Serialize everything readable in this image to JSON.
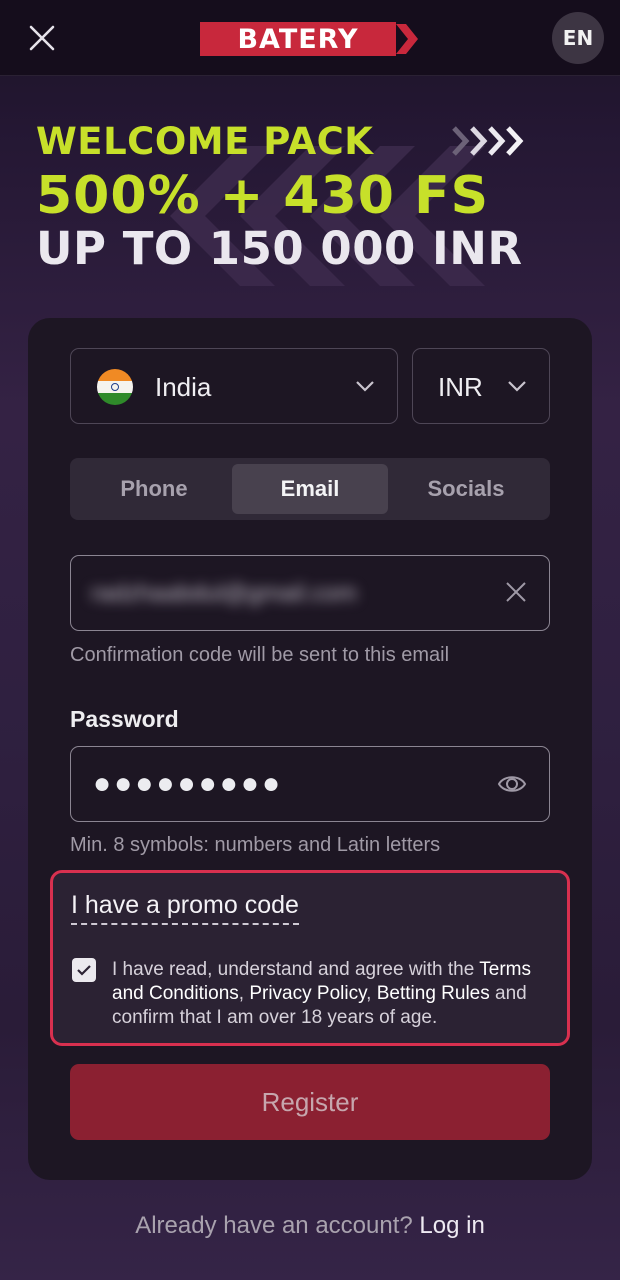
{
  "header": {
    "logo_text": "BATERY",
    "lang": "EN"
  },
  "banner": {
    "line1": "WELCOME PACK",
    "line2": "500% + 430 FS",
    "line3": "UP TO 150 000 INR"
  },
  "form": {
    "country": {
      "label": "India",
      "flag": "india-flag"
    },
    "currency": {
      "label": "INR"
    },
    "tabs": [
      {
        "label": "Phone",
        "active": false
      },
      {
        "label": "Email",
        "active": true
      },
      {
        "label": "Socials",
        "active": false
      }
    ],
    "email": {
      "value": "radzhaabdul@gmail.com",
      "hint": "Confirmation code will be sent to this email"
    },
    "password": {
      "label": "Password",
      "value": "●●●●●●●●●",
      "hint": "Min. 8 symbols: numbers and Latin letters"
    },
    "promo": {
      "link": "I have a promo code",
      "checked": true,
      "agree_pre": "I have read, understand and agree with the ",
      "terms": "Terms and Conditions",
      "sep1": ", ",
      "privacy": "Privacy Policy",
      "sep2": ", ",
      "betting_rules": "Betting Rules",
      "agree_post": " and confirm that I am over 18 years of age."
    },
    "register_label": "Register"
  },
  "footer": {
    "question": "Already have an account?",
    "login": "Log in"
  },
  "colors": {
    "accent": "#c7e02a",
    "brand": "#c8283c",
    "register": "#8b2031",
    "highlight": "#d8304f"
  }
}
